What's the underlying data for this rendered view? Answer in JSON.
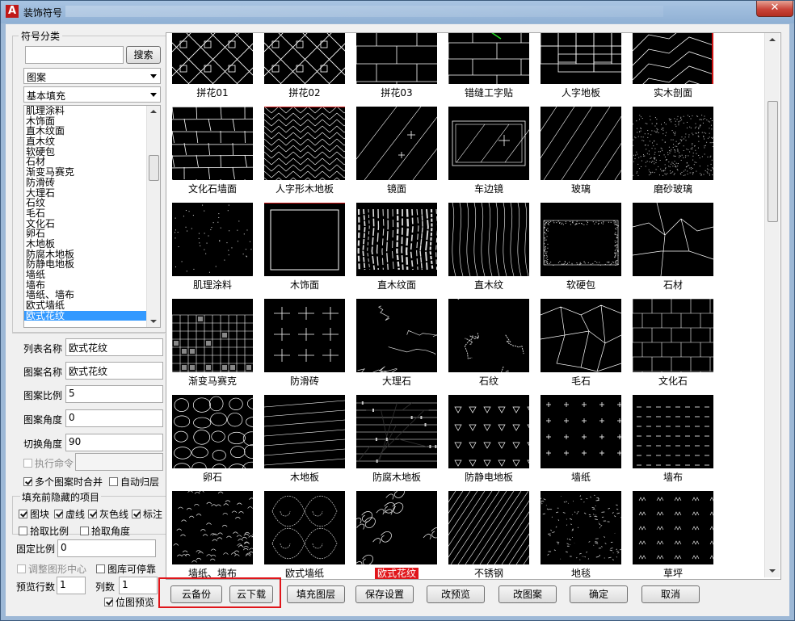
{
  "window": {
    "title": "装饰符号",
    "close_glyph": "✕"
  },
  "sidebar": {
    "group_title": "符号分类",
    "search_value": "",
    "search_button": "搜索",
    "type_select": "图案",
    "category_select": "基本填充",
    "symbol_list": [
      "肌理涂料",
      "木饰面",
      "直木纹面",
      "直木纹",
      "软硬包",
      "石材",
      "渐变马赛克",
      "防滑砖",
      "大理石",
      "石纹",
      "毛石",
      "文化石",
      "卵石",
      "木地板",
      "防腐木地板",
      "防静电地板",
      "墙纸",
      "墙布",
      "墙纸、墙布",
      "欧式墙纸",
      "欧式花纹"
    ],
    "selected_index": 20
  },
  "fields": {
    "list_name_label": "列表名称",
    "list_name_value": "欧式花纹",
    "pattern_name_label": "图案名称",
    "pattern_name_value": "欧式花纹",
    "pattern_scale_label": "图案比例",
    "pattern_scale_value": "5",
    "pattern_angle_label": "图案角度",
    "pattern_angle_value": "0",
    "switch_angle_label": "切换角度",
    "switch_angle_value": "90",
    "exec_cmd_label": "执行命令",
    "exec_cmd_value": "",
    "merge_label": "多个图案时合并",
    "auto_layer_label": "自动归层",
    "hidden_group_title": "填充前隐藏的项目",
    "hide_block_label": "图块",
    "hide_dashed_label": "虚线",
    "hide_gray_label": "灰色线",
    "hide_annot_label": "标注",
    "pick_scale_label": "拾取比例",
    "pick_angle_label": "拾取角度",
    "fixed_scale_label": "固定比例",
    "fixed_scale_value": "0",
    "adjust_center_label": "调整图形中心",
    "dock_label": "图库可停靠",
    "preview_rows_label": "预览行数",
    "preview_rows_value": "1",
    "columns_label": "列数",
    "columns_value": "1",
    "bitmap_preview_label": "位图预览"
  },
  "gallery": {
    "rows": [
      [
        "拼花01",
        "拼花02",
        "拼花03",
        "错缝工字贴",
        "人字地板",
        "实木剖面"
      ],
      [
        "文化石墙面",
        "人字形木地板",
        "镜面",
        "车边镜",
        "玻璃",
        "磨砂玻璃"
      ],
      [
        "肌理涂料",
        "木饰面",
        "直木纹面",
        "直木纹",
        "软硬包",
        "石材"
      ],
      [
        "渐变马赛克",
        "防滑砖",
        "大理石",
        "石纹",
        "毛石",
        "文化石"
      ],
      [
        "卵石",
        "木地板",
        "防腐木地板",
        "防静电地板",
        "墙纸",
        "墙布"
      ],
      [
        "墙纸、墙布",
        "欧式墙纸",
        "欧式花纹",
        "不锈钢",
        "地毯",
        "草坪"
      ]
    ],
    "selected_caption": "欧式花纹"
  },
  "buttons": {
    "cloud_backup": "云备份",
    "cloud_download": "云下载",
    "fill_layer": "填充图层",
    "save_settings": "保存设置",
    "change_preview": "改预览",
    "change_pattern": "改图案",
    "ok": "确定",
    "cancel": "取消"
  },
  "colors": {
    "selection": "#3399ff",
    "highlight": "#e0151a",
    "tile_bg": "#000000"
  }
}
